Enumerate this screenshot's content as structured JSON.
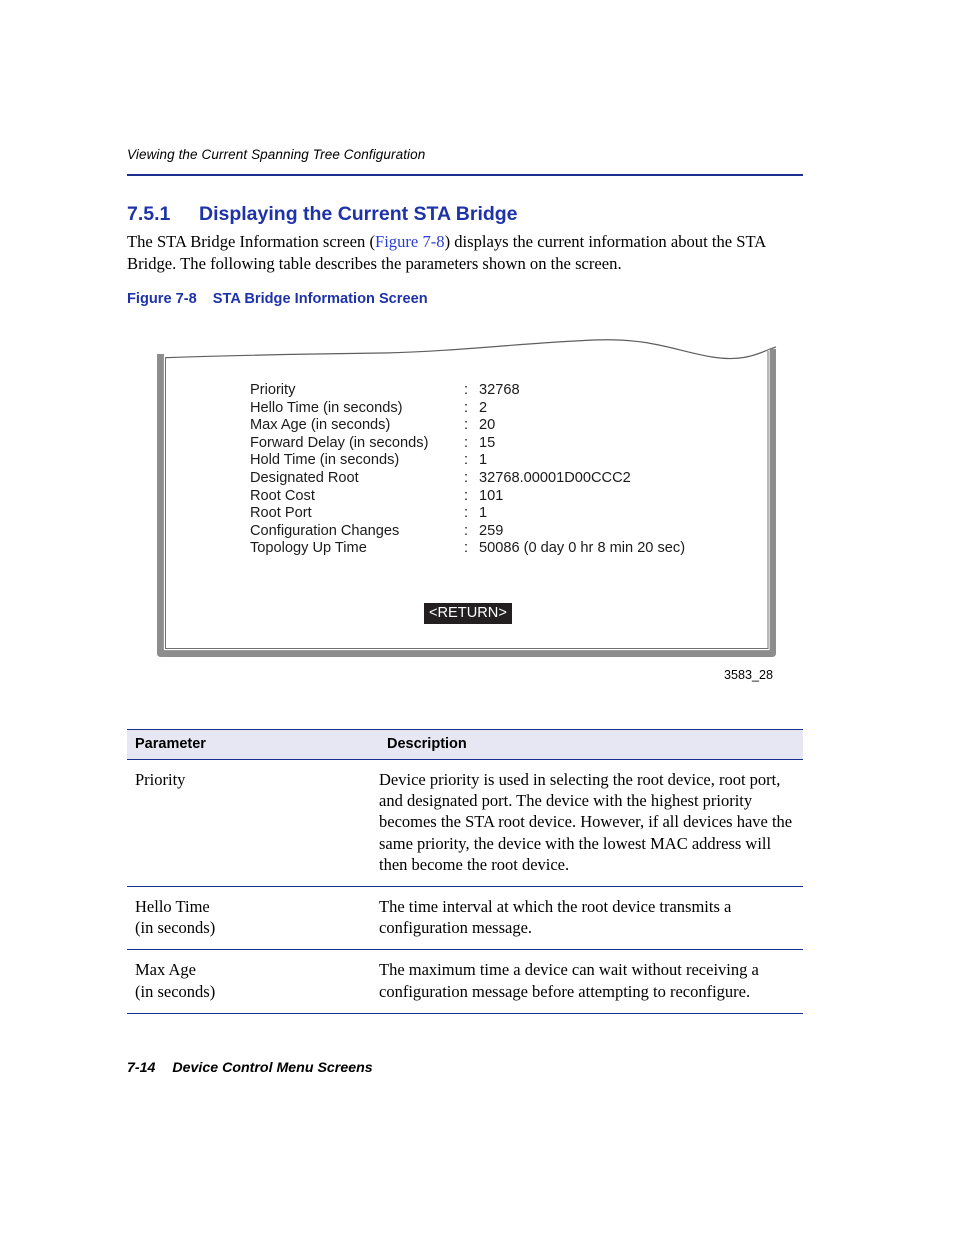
{
  "running_head": "Viewing the Current Spanning Tree Configuration",
  "section": {
    "number": "7.5.1",
    "title": "Displaying the Current STA Bridge"
  },
  "paragraph": {
    "before_link": "The STA Bridge Information screen (",
    "link": "Figure 7-8",
    "after_link": ") displays the current information about the STA Bridge. The following table describes the parameters shown on the screen."
  },
  "figure": {
    "caption_number": "Figure 7-8",
    "caption_title": "STA Bridge Information Screen",
    "id_label": "3583_28",
    "button_label": "<RETURN>",
    "rows": [
      {
        "label": "Priority",
        "sep": ":",
        "value": "32768"
      },
      {
        "label": "Hello Time (in seconds)",
        "sep": ":",
        "value": "2"
      },
      {
        "label": "Max Age (in seconds)",
        "sep": ":",
        "value": "20"
      },
      {
        "label": "Forward Delay (in seconds)",
        "sep": ":",
        "value": "15"
      },
      {
        "label": "Hold Time (in seconds)",
        "sep": ":",
        "value": "1"
      },
      {
        "label": "Designated Root",
        "sep": ":",
        "value": "32768.00001D00CCC2"
      },
      {
        "label": "Root Cost",
        "sep": ":",
        "value": "101"
      },
      {
        "label": "Root Port",
        "sep": ":",
        "value": "1"
      },
      {
        "label": "Configuration Changes",
        "sep": ":",
        "value": "259"
      },
      {
        "label": "Topology Up Time",
        "sep": ":",
        "value": "50086 (0 day 0 hr 8 min 20 sec)"
      }
    ]
  },
  "table": {
    "headers": [
      "Parameter",
      "Description"
    ],
    "rows": [
      {
        "name": "Priority",
        "name_sub": "",
        "description": "Device priority is used in selecting the root device, root port, and designated port. The device with the highest priority becomes the STA root device. However, if all devices have the same priority, the device with the lowest MAC address will then become the root device."
      },
      {
        "name": "Hello Time",
        "name_sub": "(in seconds)",
        "description": "The time interval at which the root device transmits a configuration message."
      },
      {
        "name": "Max Age",
        "name_sub": "(in seconds)",
        "description": "The maximum time a device can wait without receiving a configuration message before attempting to reconfigure."
      }
    ]
  },
  "footer": {
    "page_number": "7-14",
    "text": "Device Control Menu Screens"
  },
  "colors": {
    "heading_blue": "#1f33a8",
    "rule_navy": "#1b2f8f",
    "link_blue": "#2a3fd0",
    "table_header_bg": "#e6e7f2",
    "screen_border_gray": "#8d8d8d",
    "button_black": "#231f20"
  }
}
